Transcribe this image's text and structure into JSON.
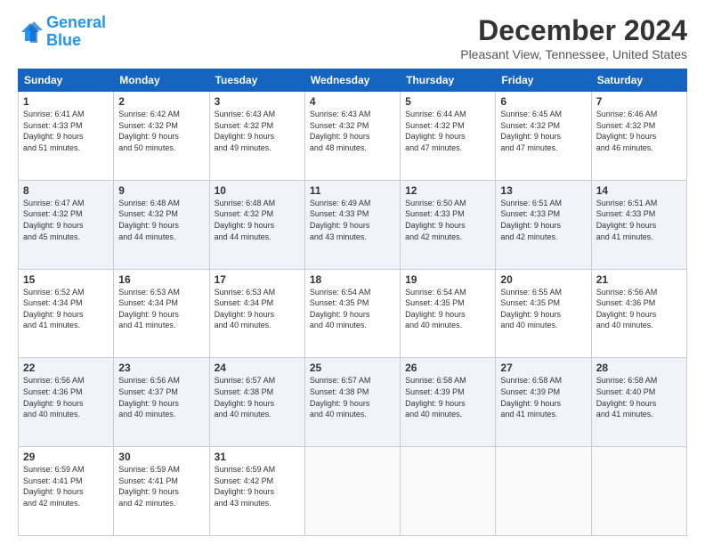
{
  "header": {
    "logo_line1": "General",
    "logo_line2": "Blue",
    "main_title": "December 2024",
    "subtitle": "Pleasant View, Tennessee, United States"
  },
  "calendar": {
    "headers": [
      "Sunday",
      "Monday",
      "Tuesday",
      "Wednesday",
      "Thursday",
      "Friday",
      "Saturday"
    ],
    "rows": [
      [
        {
          "day": "1",
          "info": "Sunrise: 6:41 AM\nSunset: 4:33 PM\nDaylight: 9 hours\nand 51 minutes."
        },
        {
          "day": "2",
          "info": "Sunrise: 6:42 AM\nSunset: 4:32 PM\nDaylight: 9 hours\nand 50 minutes."
        },
        {
          "day": "3",
          "info": "Sunrise: 6:43 AM\nSunset: 4:32 PM\nDaylight: 9 hours\nand 49 minutes."
        },
        {
          "day": "4",
          "info": "Sunrise: 6:43 AM\nSunset: 4:32 PM\nDaylight: 9 hours\nand 48 minutes."
        },
        {
          "day": "5",
          "info": "Sunrise: 6:44 AM\nSunset: 4:32 PM\nDaylight: 9 hours\nand 47 minutes."
        },
        {
          "day": "6",
          "info": "Sunrise: 6:45 AM\nSunset: 4:32 PM\nDaylight: 9 hours\nand 47 minutes."
        },
        {
          "day": "7",
          "info": "Sunrise: 6:46 AM\nSunset: 4:32 PM\nDaylight: 9 hours\nand 46 minutes."
        }
      ],
      [
        {
          "day": "8",
          "info": "Sunrise: 6:47 AM\nSunset: 4:32 PM\nDaylight: 9 hours\nand 45 minutes."
        },
        {
          "day": "9",
          "info": "Sunrise: 6:48 AM\nSunset: 4:32 PM\nDaylight: 9 hours\nand 44 minutes."
        },
        {
          "day": "10",
          "info": "Sunrise: 6:48 AM\nSunset: 4:32 PM\nDaylight: 9 hours\nand 44 minutes."
        },
        {
          "day": "11",
          "info": "Sunrise: 6:49 AM\nSunset: 4:33 PM\nDaylight: 9 hours\nand 43 minutes."
        },
        {
          "day": "12",
          "info": "Sunrise: 6:50 AM\nSunset: 4:33 PM\nDaylight: 9 hours\nand 42 minutes."
        },
        {
          "day": "13",
          "info": "Sunrise: 6:51 AM\nSunset: 4:33 PM\nDaylight: 9 hours\nand 42 minutes."
        },
        {
          "day": "14",
          "info": "Sunrise: 6:51 AM\nSunset: 4:33 PM\nDaylight: 9 hours\nand 41 minutes."
        }
      ],
      [
        {
          "day": "15",
          "info": "Sunrise: 6:52 AM\nSunset: 4:34 PM\nDaylight: 9 hours\nand 41 minutes."
        },
        {
          "day": "16",
          "info": "Sunrise: 6:53 AM\nSunset: 4:34 PM\nDaylight: 9 hours\nand 41 minutes."
        },
        {
          "day": "17",
          "info": "Sunrise: 6:53 AM\nSunset: 4:34 PM\nDaylight: 9 hours\nand 40 minutes."
        },
        {
          "day": "18",
          "info": "Sunrise: 6:54 AM\nSunset: 4:35 PM\nDaylight: 9 hours\nand 40 minutes."
        },
        {
          "day": "19",
          "info": "Sunrise: 6:54 AM\nSunset: 4:35 PM\nDaylight: 9 hours\nand 40 minutes."
        },
        {
          "day": "20",
          "info": "Sunrise: 6:55 AM\nSunset: 4:35 PM\nDaylight: 9 hours\nand 40 minutes."
        },
        {
          "day": "21",
          "info": "Sunrise: 6:56 AM\nSunset: 4:36 PM\nDaylight: 9 hours\nand 40 minutes."
        }
      ],
      [
        {
          "day": "22",
          "info": "Sunrise: 6:56 AM\nSunset: 4:36 PM\nDaylight: 9 hours\nand 40 minutes."
        },
        {
          "day": "23",
          "info": "Sunrise: 6:56 AM\nSunset: 4:37 PM\nDaylight: 9 hours\nand 40 minutes."
        },
        {
          "day": "24",
          "info": "Sunrise: 6:57 AM\nSunset: 4:38 PM\nDaylight: 9 hours\nand 40 minutes."
        },
        {
          "day": "25",
          "info": "Sunrise: 6:57 AM\nSunset: 4:38 PM\nDaylight: 9 hours\nand 40 minutes."
        },
        {
          "day": "26",
          "info": "Sunrise: 6:58 AM\nSunset: 4:39 PM\nDaylight: 9 hours\nand 40 minutes."
        },
        {
          "day": "27",
          "info": "Sunrise: 6:58 AM\nSunset: 4:39 PM\nDaylight: 9 hours\nand 41 minutes."
        },
        {
          "day": "28",
          "info": "Sunrise: 6:58 AM\nSunset: 4:40 PM\nDaylight: 9 hours\nand 41 minutes."
        }
      ],
      [
        {
          "day": "29",
          "info": "Sunrise: 6:59 AM\nSunset: 4:41 PM\nDaylight: 9 hours\nand 42 minutes."
        },
        {
          "day": "30",
          "info": "Sunrise: 6:59 AM\nSunset: 4:41 PM\nDaylight: 9 hours\nand 42 minutes."
        },
        {
          "day": "31",
          "info": "Sunrise: 6:59 AM\nSunset: 4:42 PM\nDaylight: 9 hours\nand 43 minutes."
        },
        {
          "day": "",
          "info": ""
        },
        {
          "day": "",
          "info": ""
        },
        {
          "day": "",
          "info": ""
        },
        {
          "day": "",
          "info": ""
        }
      ]
    ]
  }
}
